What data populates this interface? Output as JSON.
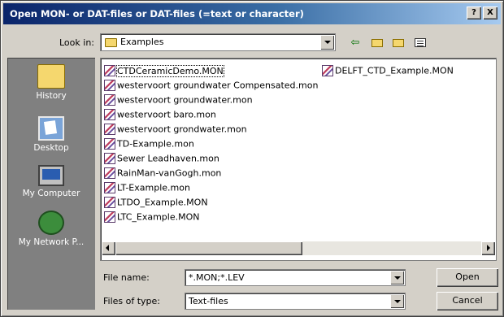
{
  "dialog": {
    "title": "Open MON- or DAT-files or DAT-files (=text or character)",
    "help_button": "?",
    "close_button": "X"
  },
  "lookin": {
    "label": "Look in:",
    "value": "Examples"
  },
  "toolbar": {
    "back_icon": "back-arrow-icon",
    "up_icon": "up-folder-icon",
    "new_folder_icon": "new-folder-icon",
    "views_icon": "views-menu-icon"
  },
  "places": [
    {
      "label": "History",
      "icon": "history-icon"
    },
    {
      "label": "Desktop",
      "icon": "desktop-icon"
    },
    {
      "label": "My Computer",
      "icon": "my-computer-icon"
    },
    {
      "label": "My Network P...",
      "icon": "network-places-icon"
    }
  ],
  "files": [
    {
      "name": "CTDCeramicDemo.MON",
      "selected": true
    },
    {
      "name": "westervoort groundwater Compensated.mon"
    },
    {
      "name": "westervoort groundwater.mon"
    },
    {
      "name": "westervoort baro.mon"
    },
    {
      "name": "westervoort grondwater.mon"
    },
    {
      "name": "TD-Example.mon"
    },
    {
      "name": "Sewer Leadhaven.mon"
    },
    {
      "name": "RainMan-vanGogh.mon"
    },
    {
      "name": "LT-Example.mon"
    },
    {
      "name": "LTDO_Example.MON"
    },
    {
      "name": "LTC_Example.MON"
    },
    {
      "name": "DELFT_CTD_Example.MON"
    }
  ],
  "filename": {
    "label": "File name:",
    "value": "*.MON;*.LEV"
  },
  "filetype": {
    "label": "Files of type:",
    "value": "Text-files"
  },
  "buttons": {
    "open": "Open",
    "cancel": "Cancel"
  }
}
